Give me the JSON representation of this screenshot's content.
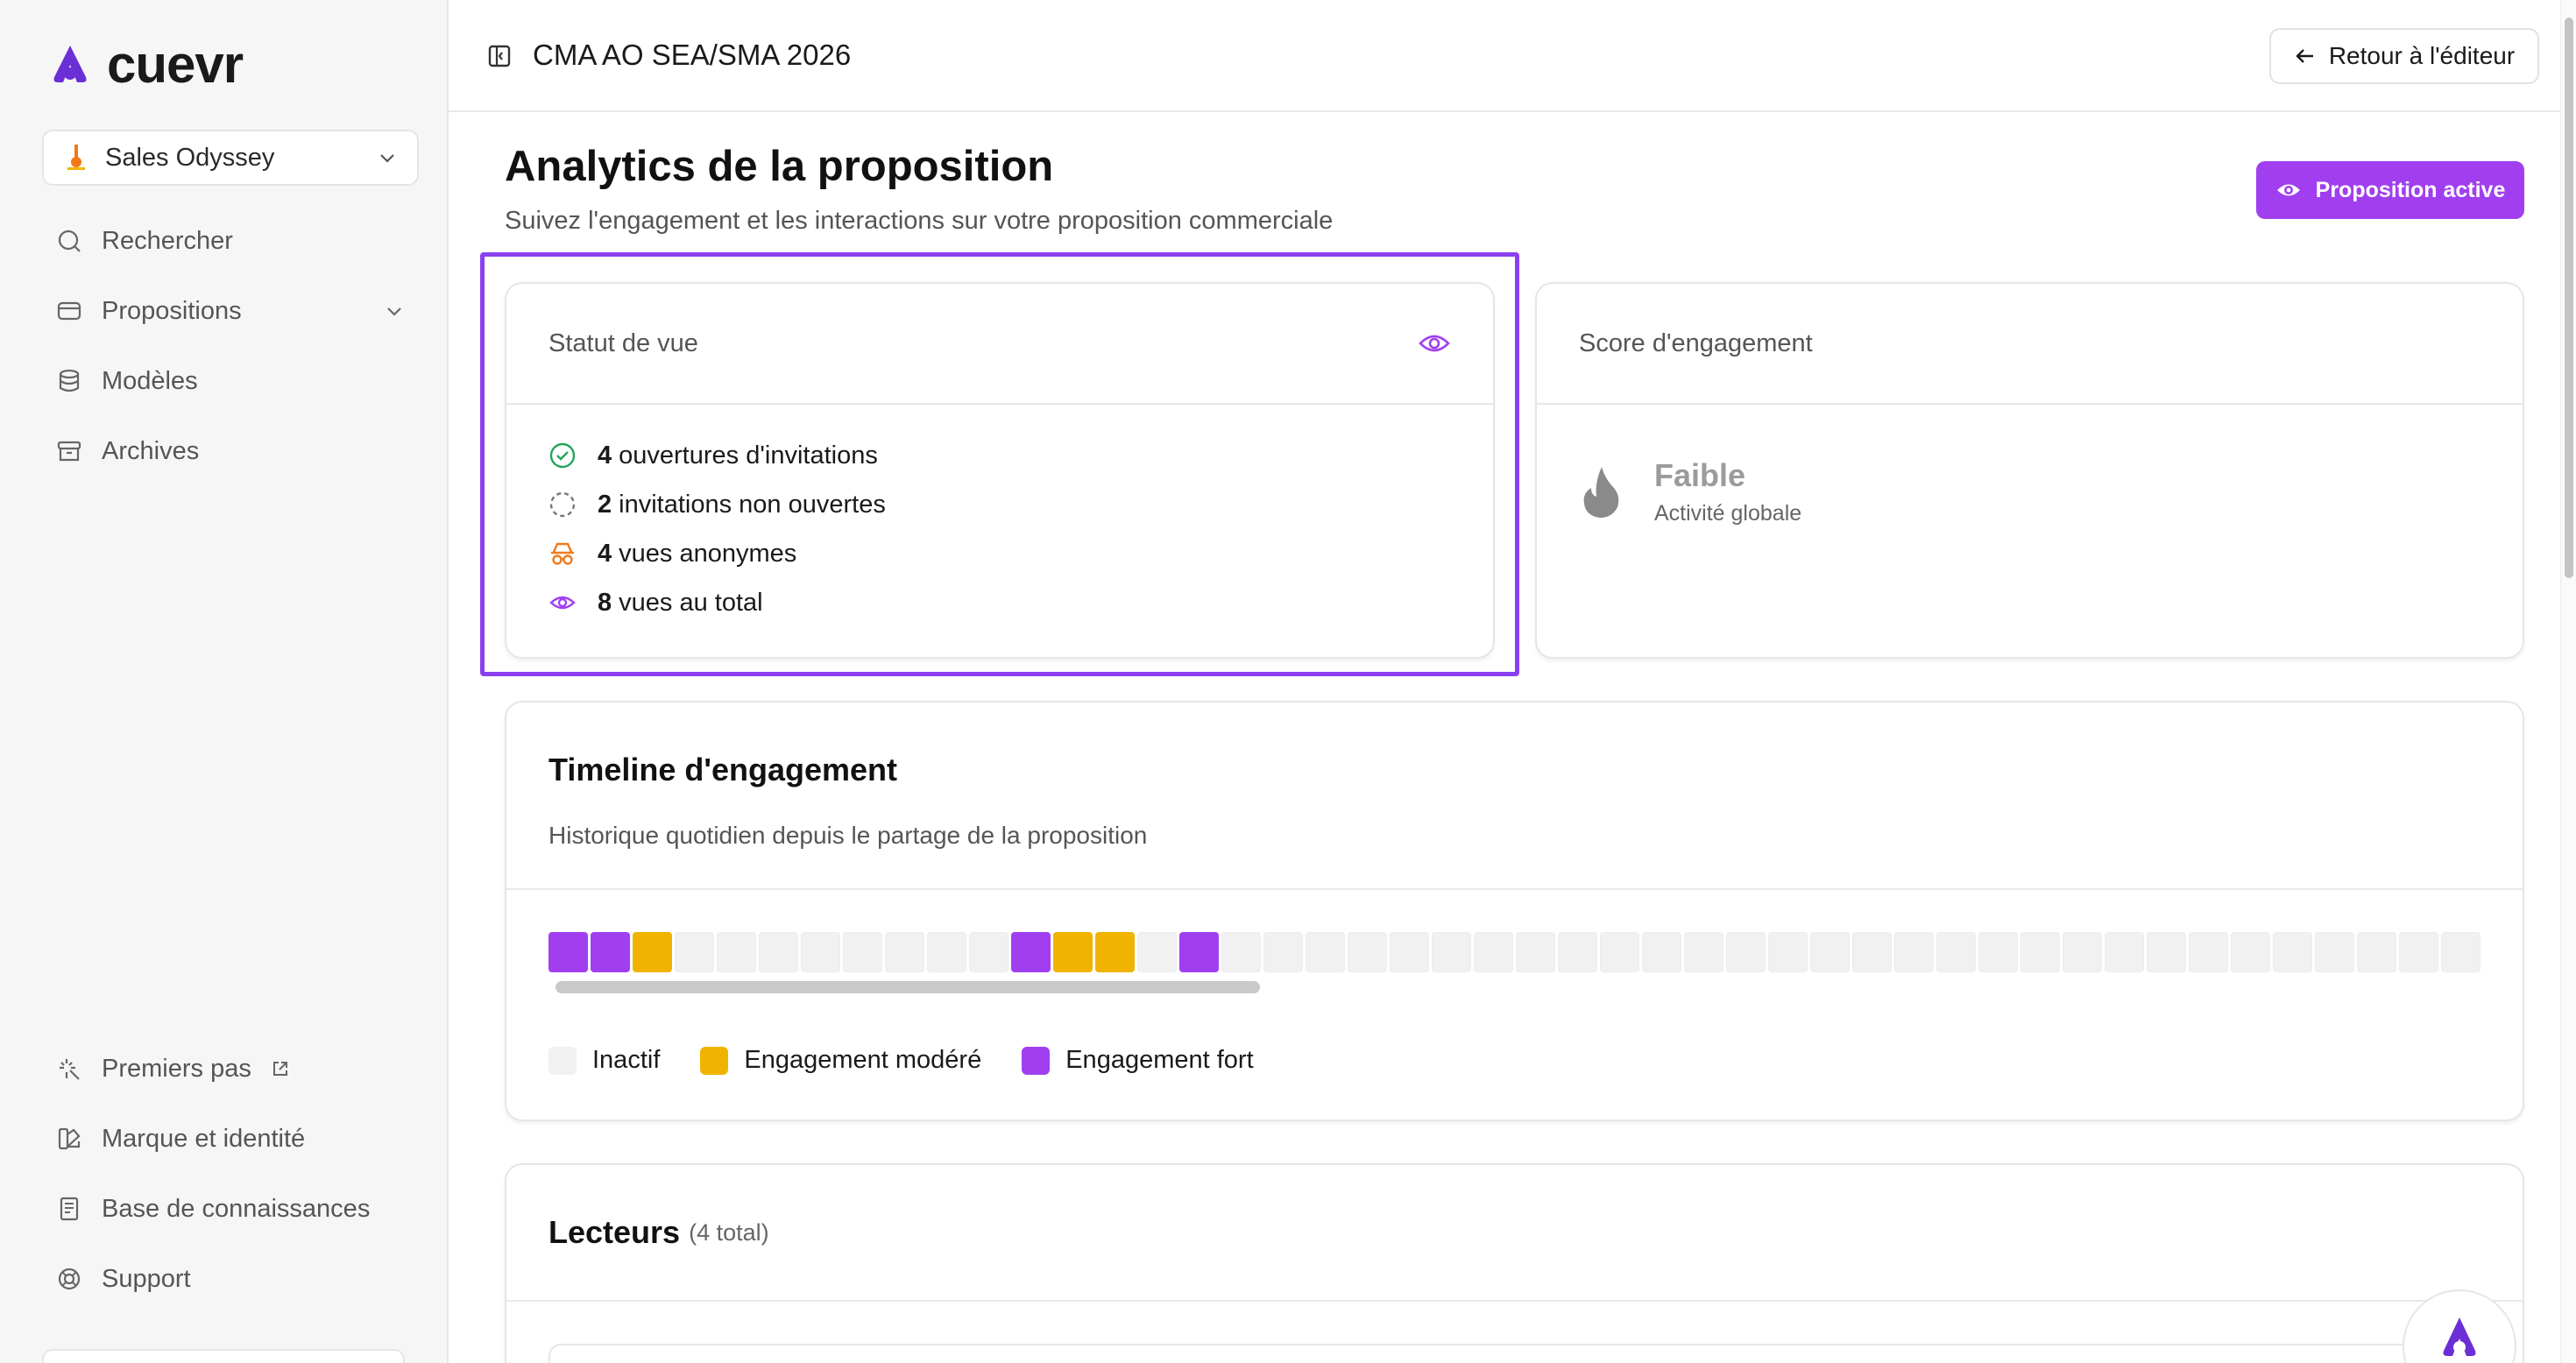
{
  "brand": {
    "name": "cuevr",
    "color": "#6b2fd6"
  },
  "workspace": {
    "name": "Sales Odyssey"
  },
  "sidebar": {
    "items": [
      {
        "label": "Rechercher",
        "icon": "search-icon"
      },
      {
        "label": "Propositions",
        "icon": "proposals-icon"
      },
      {
        "label": "Modèles",
        "icon": "database-icon"
      },
      {
        "label": "Archives",
        "icon": "archive-icon"
      }
    ],
    "bottom_items": [
      {
        "label": "Premiers pas",
        "icon": "sparkle-icon"
      },
      {
        "label": "Marque et identité",
        "icon": "brand-icon"
      },
      {
        "label": "Base de connaissances",
        "icon": "book-icon"
      },
      {
        "label": "Support",
        "icon": "lifebuoy-icon"
      }
    ]
  },
  "header": {
    "doc_title": "CMA AO SEA/SMA 2026",
    "back_label": "Retour à l'éditeur"
  },
  "page": {
    "title": "Analytics de la proposition",
    "subtitle": "Suivez l'engagement et les interactions sur votre proposition commerciale",
    "active_label": "Proposition active"
  },
  "status_card": {
    "title": "Statut de vue",
    "stats": [
      {
        "value": "4",
        "label": "ouvertures d'invitations",
        "icon": "check-circle-icon",
        "color": "#22a45d"
      },
      {
        "value": "2",
        "label": "invitations non ouvertes",
        "icon": "dashed-circle-icon",
        "color": "#777777"
      },
      {
        "value": "4",
        "label": "vues anonymes",
        "icon": "incognito-icon",
        "color": "#f07a1a"
      },
      {
        "value": "8",
        "label": "vues au total",
        "icon": "eye-icon",
        "color": "#a13ff0"
      }
    ]
  },
  "score_card": {
    "title": "Score d'engagement",
    "level": "Faible",
    "sub": "Activité globale"
  },
  "timeline": {
    "title": "Timeline d'engagement",
    "subtitle": "Historique quotidien depuis le partage de la proposition",
    "days": [
      "strong",
      "strong",
      "moderate",
      "inactive",
      "inactive",
      "inactive",
      "inactive",
      "inactive",
      "inactive",
      "inactive",
      "inactive",
      "strong",
      "moderate",
      "moderate",
      "inactive",
      "strong",
      "inactive",
      "inactive",
      "inactive",
      "inactive",
      "inactive",
      "inactive",
      "inactive",
      "inactive",
      "inactive",
      "inactive",
      "inactive",
      "inactive",
      "inactive",
      "inactive",
      "inactive",
      "inactive",
      "inactive",
      "inactive",
      "inactive",
      "inactive",
      "inactive",
      "inactive",
      "inactive",
      "inactive",
      "inactive",
      "inactive",
      "inactive",
      "inactive",
      "inactive",
      "inactive"
    ],
    "colors": {
      "inactive": "#f1f1f1",
      "moderate": "#f0b400",
      "strong": "#a13ff0"
    },
    "legend": [
      {
        "key": "inactive",
        "label": "Inactif"
      },
      {
        "key": "moderate",
        "label": "Engagement modéré"
      },
      {
        "key": "strong",
        "label": "Engagement fort"
      }
    ]
  },
  "readers": {
    "title": "Lecteurs",
    "count": "(4 total)"
  },
  "colors": {
    "accent": "#a13ff0",
    "highlight": "#8a3ff0"
  }
}
